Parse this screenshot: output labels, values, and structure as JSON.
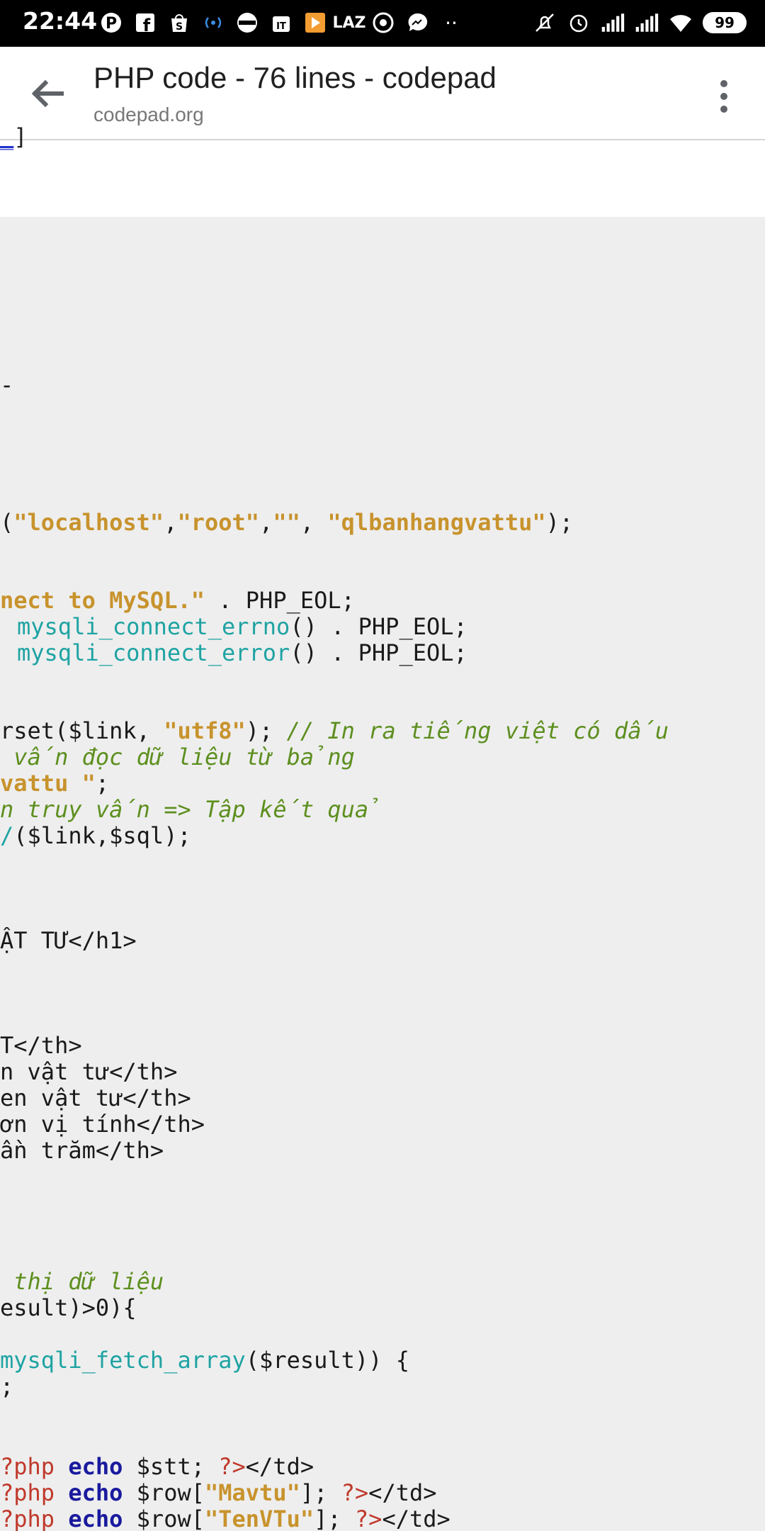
{
  "status_bar": {
    "time": "22:44",
    "battery": "99",
    "left_icons": [
      "pinterest-icon",
      "facebook-icon",
      "shopee-icon",
      "signal-broadcast-icon",
      "app-icon",
      "tiki-icon",
      "play-icon",
      "lazada-icon",
      "chrome-icon",
      "messenger-icon",
      "more-dots-icon"
    ],
    "lazada_label": "LAZ",
    "more_dots": "··",
    "right_icons": [
      "mute-icon",
      "alarm-icon",
      "cellular-1-icon",
      "cellular-2-icon",
      "wifi-icon",
      "battery-icon"
    ]
  },
  "app_bar": {
    "title": "PHP code - 76 lines - codepad",
    "url": "codepad.org"
  },
  "strip": {
    "fragment_link": "_",
    "fragment_tail": "]"
  },
  "code": {
    "l1_a": "-",
    "l2_a": "(",
    "l2_s1": "\"localhost\"",
    "l2_b": ",",
    "l2_s2": "\"root\"",
    "l2_c": ",",
    "l2_s3": "\"\"",
    "l2_d": ", ",
    "l2_s4": "\"qlbanhangvattu\"",
    "l2_e": ");",
    "l3_s": "nect to MySQL.\"",
    "l3_b": " . PHP_EOL;",
    "l4_fn": "mysqli_connect_errno",
    "l4_b": "() . PHP_EOL;",
    "l5_fn": "mysqli_connect_error",
    "l5_b": "() . PHP_EOL;",
    "l6_a": "rset($link, ",
    "l6_s": "\"utf8\"",
    "l6_b": "); ",
    "l6_c": "// In ra tiếng việt có dấu",
    "l7_c": " vấn đọc dữ liệu từ bảng",
    "l8_s": "vattu \"",
    "l8_b": ";",
    "l9_c": "n truy vấn => Tập kết quả",
    "l10_fn": "/",
    "l10_b": "($link,$sql);",
    "l11": "ẬT TƯ</h1>",
    "l12": "T</th>",
    "l13": "n vật tư</th>",
    "l14": "en vật tư</th>",
    "l15": "ơn vị tính</th>",
    "l16": "ần trăm</th>",
    "l17_c": " thị dữ liệu",
    "l18": "esult)>0){",
    "l19_fn": "mysqli_fetch_array",
    "l19_b": "($result)) {",
    "l20": ";",
    "l21_ph": "?php ",
    "l21_kw": "echo",
    "l21_b": " $stt; ",
    "l21_ph2": "?>",
    "l21_c": "</td>",
    "l22_ph": "?php ",
    "l22_kw": "echo",
    "l22_b": " $row[",
    "l22_s": "\"Mavtu\"",
    "l22_c": "]; ",
    "l22_ph2": "?>",
    "l22_d": "</td>",
    "l23_ph": "?php ",
    "l23_kw": "echo",
    "l23_b": " $row[",
    "l23_s": "\"TenVTu\"",
    "l23_c": "]; ",
    "l23_ph2": "?>",
    "l23_d": "</td>"
  }
}
